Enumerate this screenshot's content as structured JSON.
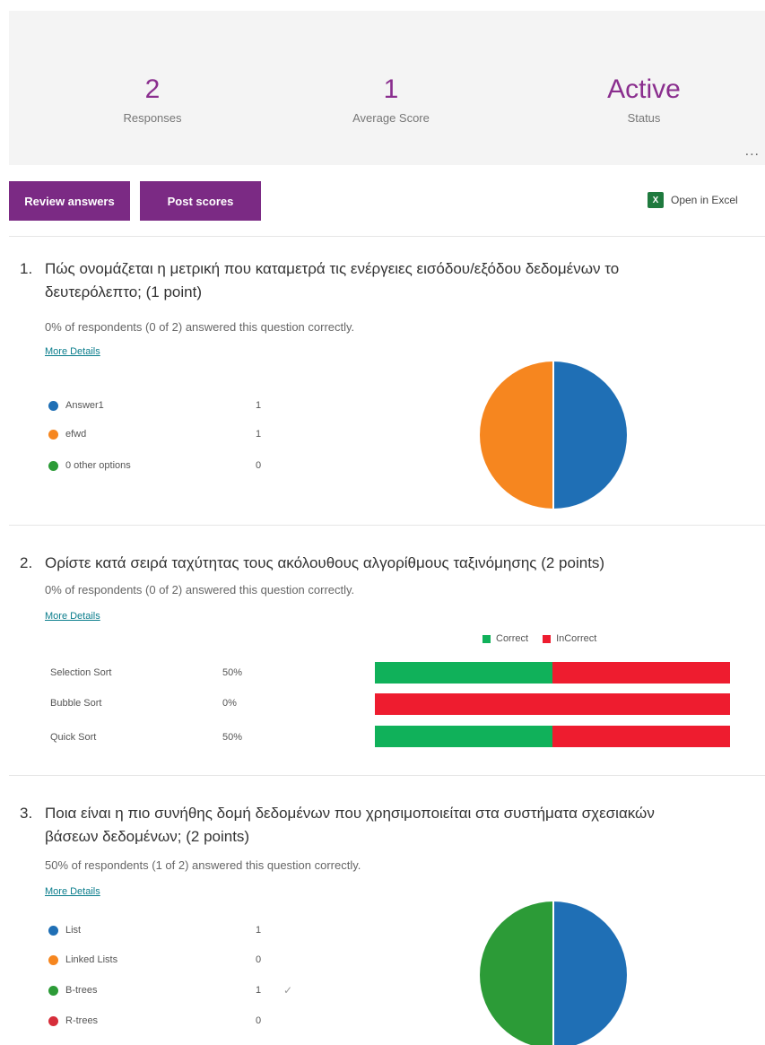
{
  "summary": {
    "responses": {
      "value": "2",
      "label": "Responses"
    },
    "average_score": {
      "value": "1",
      "label": "Average Score"
    },
    "status": {
      "value": "Active",
      "label": "Status"
    },
    "more": "..."
  },
  "toolbar": {
    "review_label": "Review answers",
    "post_label": "Post scores",
    "excel_label": "Open in Excel",
    "excel_icon": "X"
  },
  "colors": {
    "accent": "#7b2a84",
    "blue": "#1f6fb5",
    "orange": "#f6861f",
    "green": "#2c9b37",
    "red": "#d62d3a",
    "correct": "#10b15a",
    "incorrect": "#ee1c2f"
  },
  "questions": [
    {
      "number": "1.",
      "title_line1": "Πώς ονομάζεται η μετρική που καταμετρά τις ενέργειες εισόδου/εξόδου δεδομένων το",
      "title_line2": "δευτερόλεπτο; (1 point)",
      "stat": "0% of respondents (0 of 2) answered this question correctly.",
      "more_details": "More Details",
      "options": [
        {
          "label": "Answer1",
          "count": "1",
          "color": "#1f6fb5"
        },
        {
          "label": "efwd",
          "count": "1",
          "color": "#f6861f"
        },
        {
          "label": "0 other options",
          "count": "0",
          "color": "#2c9b37"
        }
      ]
    },
    {
      "number": "2.",
      "title_line1": "Ορίστε κατά σειρά ταχύτητας τους ακόλουθους αλγορίθμους ταξινόμησης (2 points)",
      "stat": "0% of respondents (0 of 2) answered this question correctly.",
      "more_details": "More Details",
      "legend": {
        "correct": "Correct",
        "incorrect": "InCorrect"
      },
      "rows": [
        {
          "label": "Selection Sort",
          "pct": "50%",
          "correct": 0.5
        },
        {
          "label": "Bubble Sort",
          "pct": "0%",
          "correct": 0
        },
        {
          "label": "Quick Sort",
          "pct": "50%",
          "correct": 0.5
        }
      ]
    },
    {
      "number": "3.",
      "title_line1": "Ποια είναι η πιο συνήθης δομή δεδομένων που χρησιμοποιείται στα συστήματα σχεσιακών",
      "title_line2": "βάσεων δεδομένων; (2 points)",
      "stat": "50% of respondents (1 of 2) answered this question correctly.",
      "more_details": "More Details",
      "options": [
        {
          "label": "List",
          "count": "1",
          "color": "#1f6fb5"
        },
        {
          "label": "Linked Lists",
          "count": "0",
          "color": "#f6861f"
        },
        {
          "label": "B-trees",
          "count": "1",
          "color": "#2c9b37",
          "check": "✓"
        },
        {
          "label": "R-trees",
          "count": "0",
          "color": "#d62d3a"
        }
      ]
    }
  ]
}
